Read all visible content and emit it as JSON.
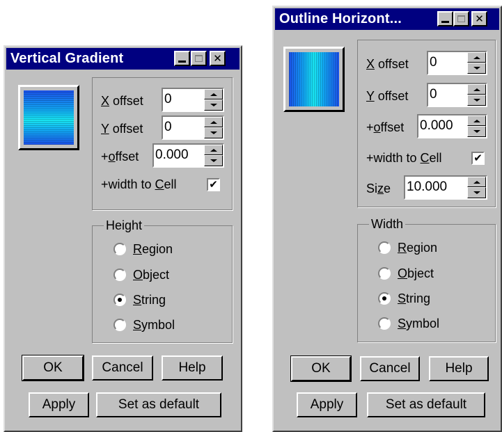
{
  "dialog1": {
    "title": "Vertical Gradient",
    "x_offset": {
      "label_pre": "",
      "label_key": "X",
      "label_post": " offset",
      "value": "0"
    },
    "y_offset": {
      "label_pre": "",
      "label_key": "Y",
      "label_post": " offset",
      "value": "0"
    },
    "plus_offset": {
      "label_pre": "+",
      "label_key": "o",
      "label_post": "ffset",
      "value": "0.000"
    },
    "width_to_cell": {
      "label_pre": "+width to ",
      "label_key": "C",
      "label_post": "ell",
      "checked": true,
      "mark": "✔"
    },
    "group": {
      "legend": "Height",
      "options": [
        {
          "key": "R",
          "rest": "egion",
          "selected": false
        },
        {
          "key": "O",
          "rest": "bject",
          "selected": false
        },
        {
          "key": "S",
          "rest": "tring",
          "selected": true
        },
        {
          "key": "S",
          "rest": "ymbol",
          "selected": false
        }
      ]
    },
    "buttons": {
      "ok": "OK",
      "cancel": "Cancel",
      "help": "Help",
      "apply": "Apply",
      "set_default": "Set as default"
    }
  },
  "dialog2": {
    "title": "Outline Horizont...",
    "x_offset": {
      "label_pre": "",
      "label_key": "X",
      "label_post": " offset",
      "value": "0"
    },
    "y_offset": {
      "label_pre": "",
      "label_key": "Y",
      "label_post": " offset",
      "value": "0"
    },
    "plus_offset": {
      "label_pre": "+",
      "label_key": "o",
      "label_post": "ffset",
      "value": "0.000"
    },
    "width_to_cell": {
      "label_pre": "+width to ",
      "label_key": "C",
      "label_post": "ell",
      "checked": true,
      "mark": "✔"
    },
    "size": {
      "label_pre": "Si",
      "label_key": "z",
      "label_post": "e",
      "value": "10.000"
    },
    "group": {
      "legend": "Width",
      "options": [
        {
          "key": "R",
          "rest": "egion",
          "selected": false
        },
        {
          "key": "O",
          "rest": "bject",
          "selected": false
        },
        {
          "key": "S",
          "rest": "tring",
          "selected": true
        },
        {
          "key": "S",
          "rest": "ymbol",
          "selected": false
        }
      ]
    },
    "buttons": {
      "ok": "OK",
      "cancel": "Cancel",
      "help": "Help",
      "apply": "Apply",
      "set_default": "Set as default"
    }
  },
  "icons": {
    "minimize": "minimize-icon",
    "maximize": "maximize-icon",
    "close": "close-icon",
    "close_glyph": "✕"
  },
  "colors": {
    "titlebar": "#000080",
    "face": "#c0c0c0",
    "gradient_light": "#18e4f0",
    "gradient_dark": "#1a50e8"
  }
}
